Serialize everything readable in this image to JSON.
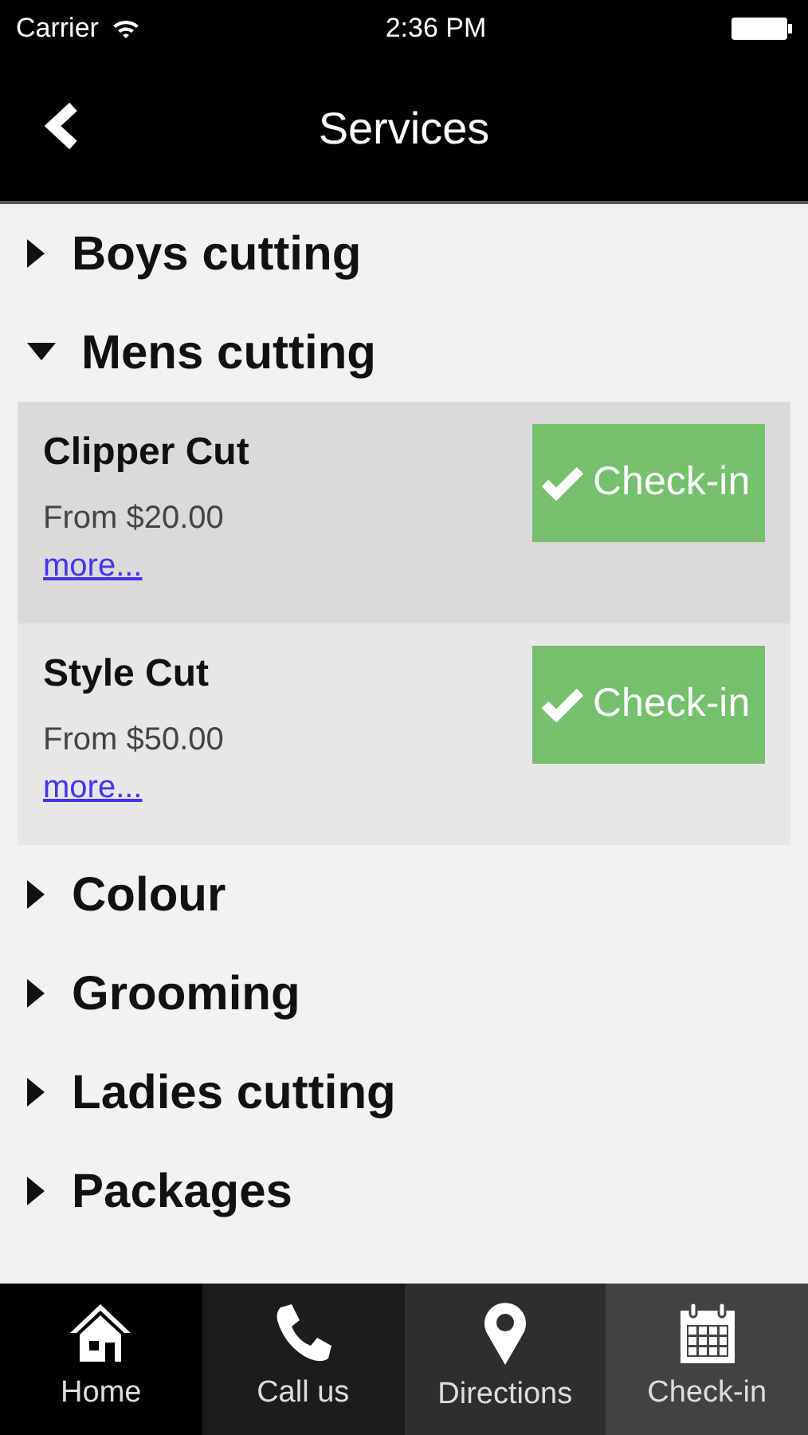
{
  "status_bar": {
    "carrier": "Carrier",
    "time": "2:36 PM"
  },
  "nav_bar": {
    "title": "Services"
  },
  "categories": [
    {
      "name": "Boys cutting",
      "expanded": false
    },
    {
      "name": "Mens cutting",
      "expanded": true,
      "services": [
        {
          "name": "Clipper Cut",
          "price": "From $20.00",
          "link": "more...",
          "button": "Check-in",
          "selected": true
        },
        {
          "name": "Style Cut",
          "price": "From $50.00",
          "link": "more...",
          "button": "Check-in",
          "selected": false
        }
      ]
    },
    {
      "name": "Colour",
      "expanded": false
    },
    {
      "name": "Grooming",
      "expanded": false
    },
    {
      "name": "Ladies cutting",
      "expanded": false
    },
    {
      "name": "Packages",
      "expanded": false
    }
  ],
  "tab_bar": [
    {
      "label": "Home",
      "kind": "home"
    },
    {
      "label": "Call us",
      "kind": "phone"
    },
    {
      "label": "Directions",
      "kind": "pin"
    },
    {
      "label": "Check-in",
      "kind": "calendar"
    }
  ]
}
